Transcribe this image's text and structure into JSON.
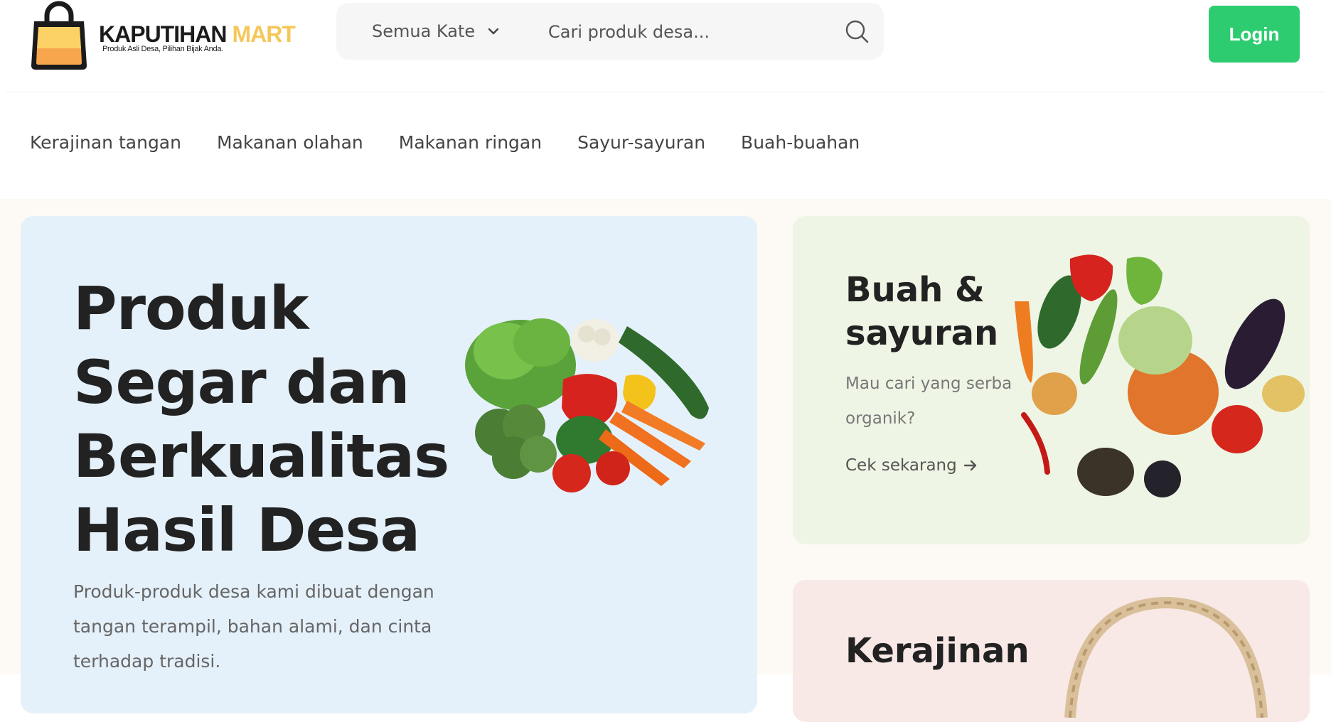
{
  "header": {
    "logo_brand": "KAPUTIHAN",
    "logo_brand_accent": "MART",
    "logo_tagline": "Produk Asli Desa, Pilihan Bijak Anda.",
    "category_select": "Semua Kate",
    "search_placeholder": "Cari produk desa...",
    "login_label": "Login"
  },
  "nav": {
    "categories": [
      "Kerajinan tangan",
      "Makanan olahan",
      "Makanan ringan",
      "Sayur-sayuran",
      "Buah-buahan"
    ]
  },
  "hero": {
    "title": "Produk Segar dan Berkualitas Hasil Desa",
    "description": "Produk-produk desa kami dibuat dengan tangan terampil, bahan alami, dan cinta terhadap tradisi."
  },
  "cards": {
    "fruit": {
      "title": "Buah & sayuran",
      "subtitle": "Mau cari yang serba organik?",
      "link": "Cek sekarang"
    },
    "craft": {
      "title": "Kerajinan"
    }
  },
  "icons": {
    "logo": "shopping-bag-icon",
    "category_dropdown": "chevron-down-icon",
    "search": "search-icon",
    "card_link": "arrow-right-icon"
  },
  "colors": {
    "accent": "#f5c75a",
    "login": "#2ecc71",
    "hero_banner": "#e5f1fa",
    "fruit_card": "#eef5e5",
    "craft_card": "#f8e9e7"
  }
}
